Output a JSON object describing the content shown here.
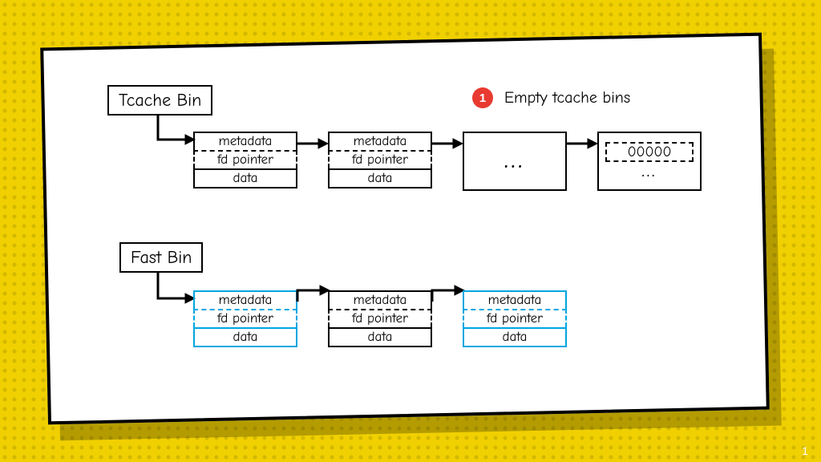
{
  "step": {
    "number": "1",
    "text": "Empty tcache bins"
  },
  "tcache": {
    "label": "Tcache Bin",
    "nodes": [
      {
        "metadata": "metadata",
        "fd": "fd pointer",
        "data": "data"
      },
      {
        "metadata": "metadata",
        "fd": "fd pointer",
        "data": "data"
      }
    ],
    "ellipsis": "...",
    "last": {
      "value": "00000",
      "ellipsis": "..."
    }
  },
  "fast": {
    "label": "Fast Bin",
    "nodes": [
      {
        "metadata": "metadata",
        "fd": "fd pointer",
        "data": "data",
        "color": "blue"
      },
      {
        "metadata": "metadata",
        "fd": "fd pointer",
        "data": "data",
        "color": "black"
      },
      {
        "metadata": "metadata",
        "fd": "fd pointer",
        "data": "data",
        "color": "blue"
      }
    ]
  },
  "pagenum": "1"
}
